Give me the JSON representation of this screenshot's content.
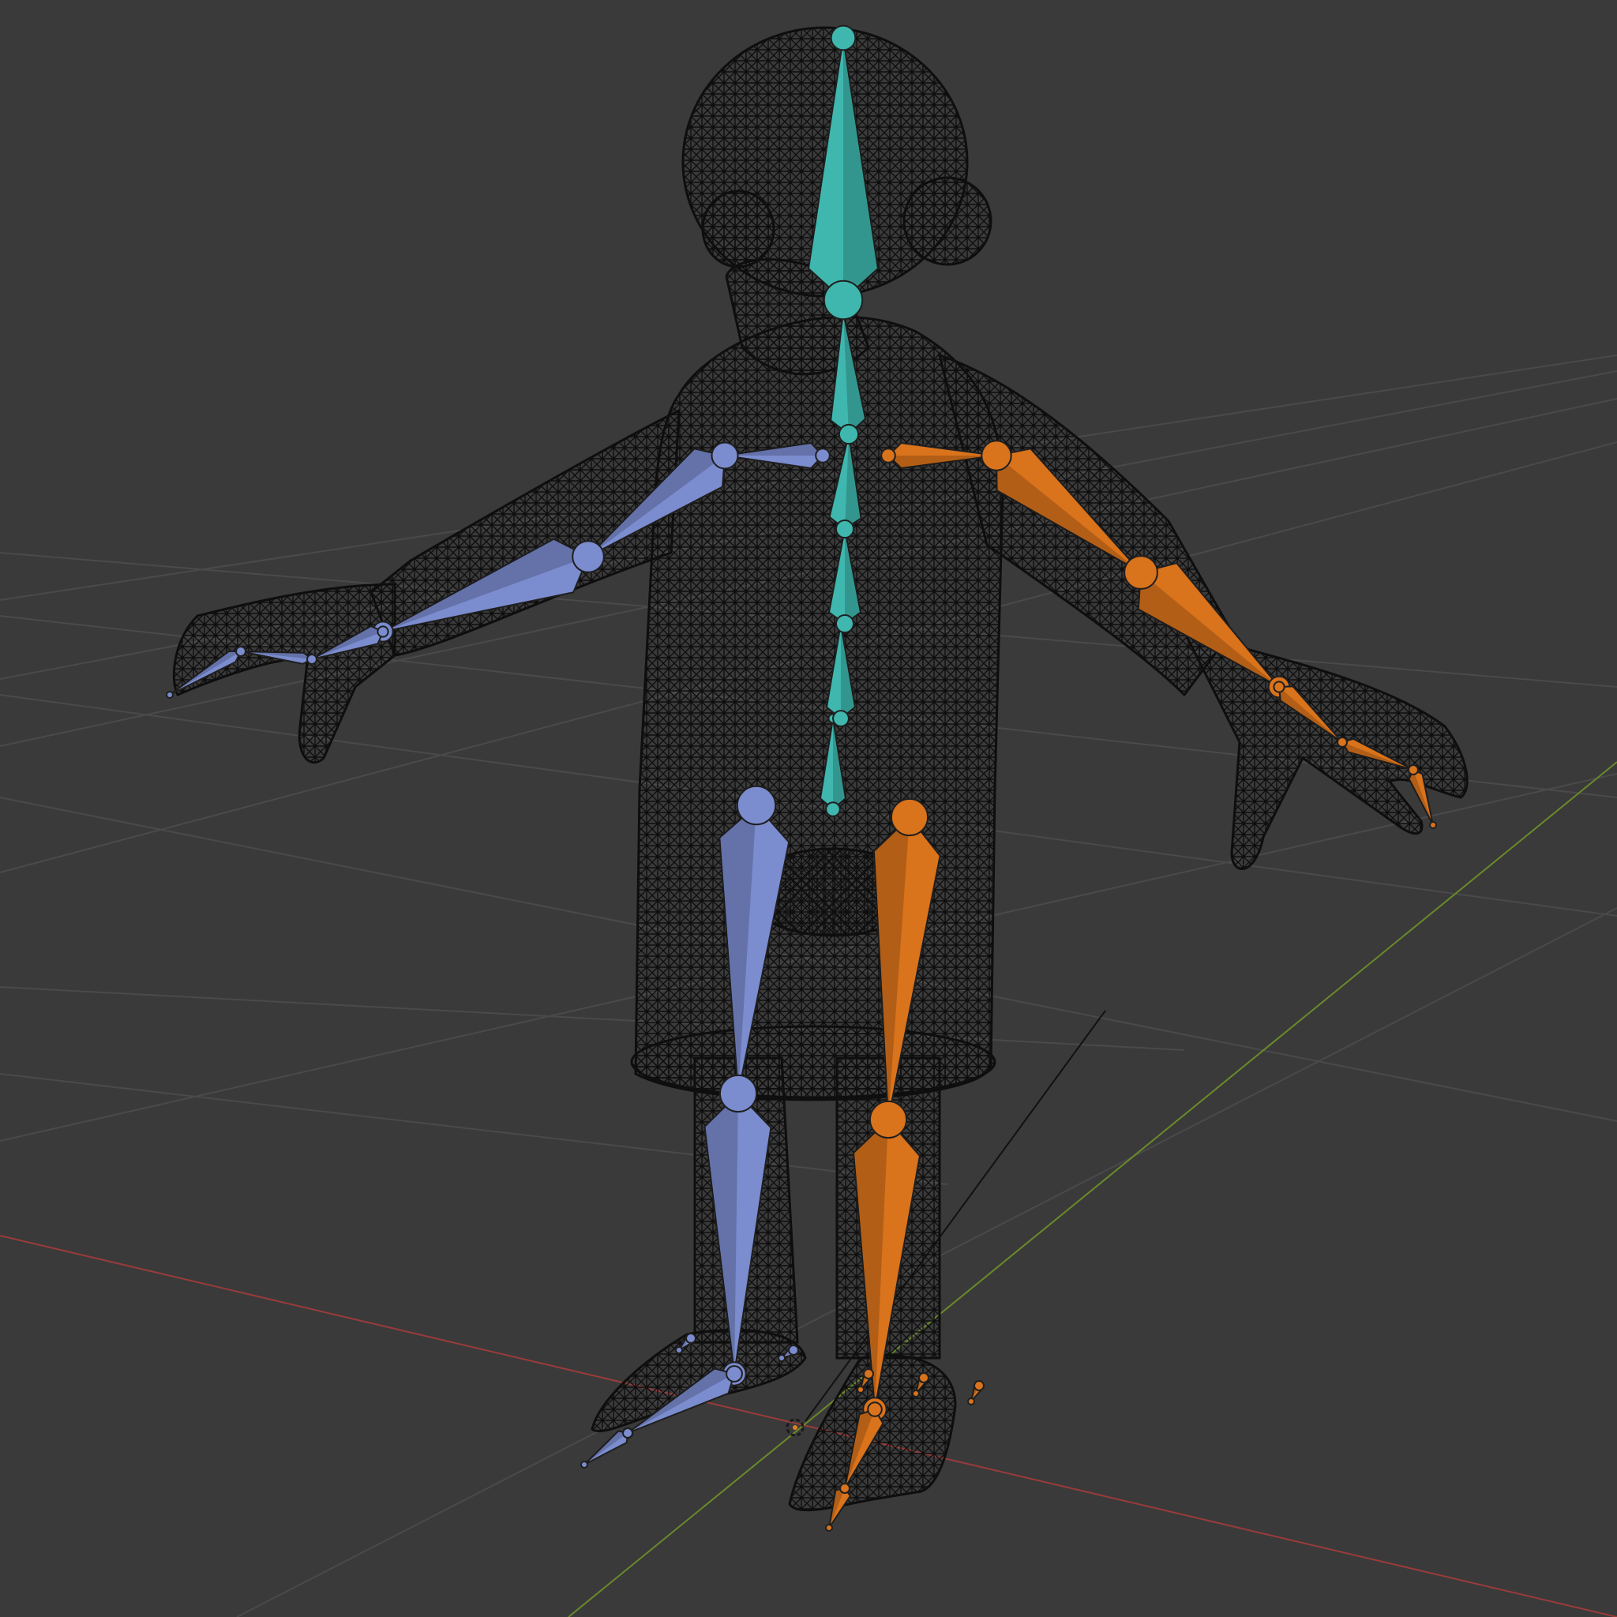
{
  "viewport": {
    "background": "#3a3a3a",
    "grid_color": "#4a4a4a",
    "x_axis_color": "#9a3b3b",
    "y_axis_color": "#6a8a2a",
    "mesh_wire_color": "#0e0e0e",
    "spine_bone_color": "#3fb7ae",
    "left_side_bone_color": "#7b8ccf",
    "right_side_bone_color": "#d9731c",
    "joint_outline_color": "#1f1f1f"
  },
  "scene": {
    "object_type": "armature-with-wireframe-mesh",
    "bones_visible": true,
    "mesh_display": "wireframe"
  }
}
